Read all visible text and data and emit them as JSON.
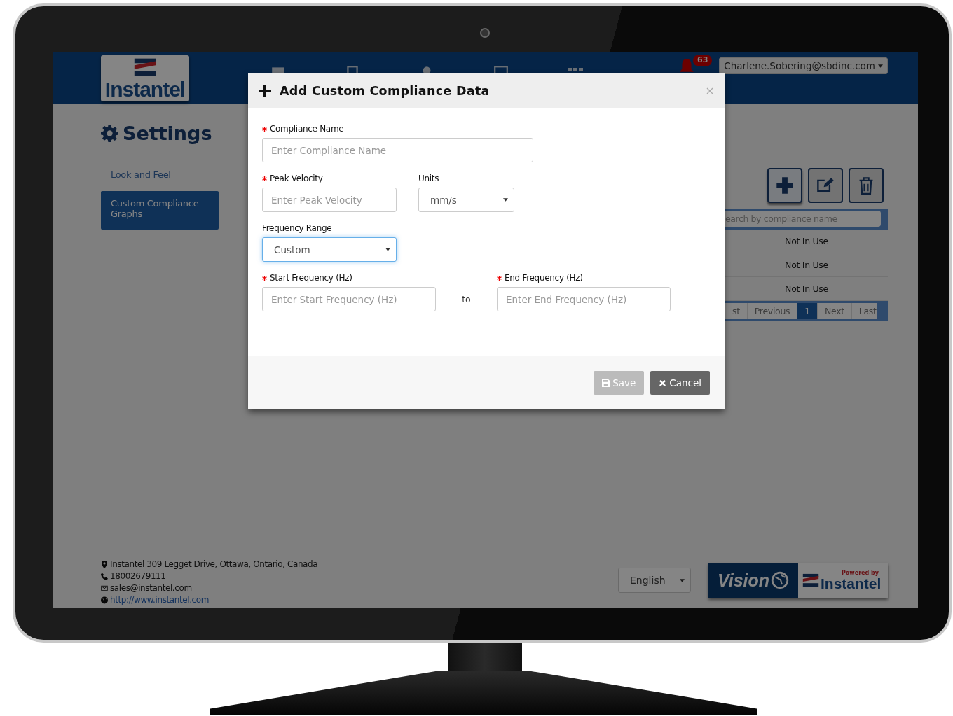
{
  "header": {
    "logo": "Instantel",
    "notifications": "63",
    "user": "Charlene.Sobering@sbdinc.com"
  },
  "page_title": "Settings",
  "sidebar": {
    "items": [
      {
        "label": "Look and Feel",
        "selected": false
      },
      {
        "label": "Custom Compliance Graphs",
        "selected": true
      }
    ]
  },
  "list": {
    "search": {
      "placeholder": "earch by compliance name"
    },
    "rows": [
      {
        "status": "Not In Use"
      },
      {
        "status": "Not In Use"
      },
      {
        "status": "Not In Use"
      }
    ],
    "pagination": [
      {
        "label": "st",
        "selected": false
      },
      {
        "label": "Previous",
        "selected": false
      },
      {
        "label": "1",
        "selected": true
      },
      {
        "label": "Next",
        "selected": false
      },
      {
        "label": "Last",
        "selected": false
      }
    ]
  },
  "footer": {
    "address": "Instantel 309 Legget Drive, Ottawa, Ontario, Canada",
    "phone": "18002679111",
    "email": "sales@instantel.com",
    "website": "http://www.instantel.com",
    "language": "English",
    "brand": "Vision",
    "powered_by": "Powered by",
    "powered_brand": "Instantel"
  },
  "modal": {
    "title": "Add Custom Compliance Data",
    "compliance_name": {
      "label": "Compliance Name",
      "required": true,
      "placeholder": "Enter Compliance Name"
    },
    "peak_velocity": {
      "label": "Peak Velocity",
      "required": true,
      "placeholder": "Enter Peak Velocity"
    },
    "units": {
      "label": "Units",
      "required": false,
      "value": "mm/s",
      "focused": false
    },
    "frequency_range": {
      "label": "Frequency Range",
      "required": false,
      "value": "Custom",
      "focused": true
    },
    "start_frequency": {
      "label": "Start Frequency (Hz)",
      "required": true,
      "placeholder": "Enter Start Frequency (Hz)"
    },
    "separator": "to",
    "end_frequency": {
      "label": "End Frequency (Hz)",
      "required": true,
      "placeholder": "Enter End Frequency (Hz)"
    },
    "buttons": [
      {
        "kind": "save",
        "label": "Save",
        "disabled": true
      },
      {
        "kind": "cancel",
        "label": "Cancel",
        "disabled": false
      }
    ]
  }
}
